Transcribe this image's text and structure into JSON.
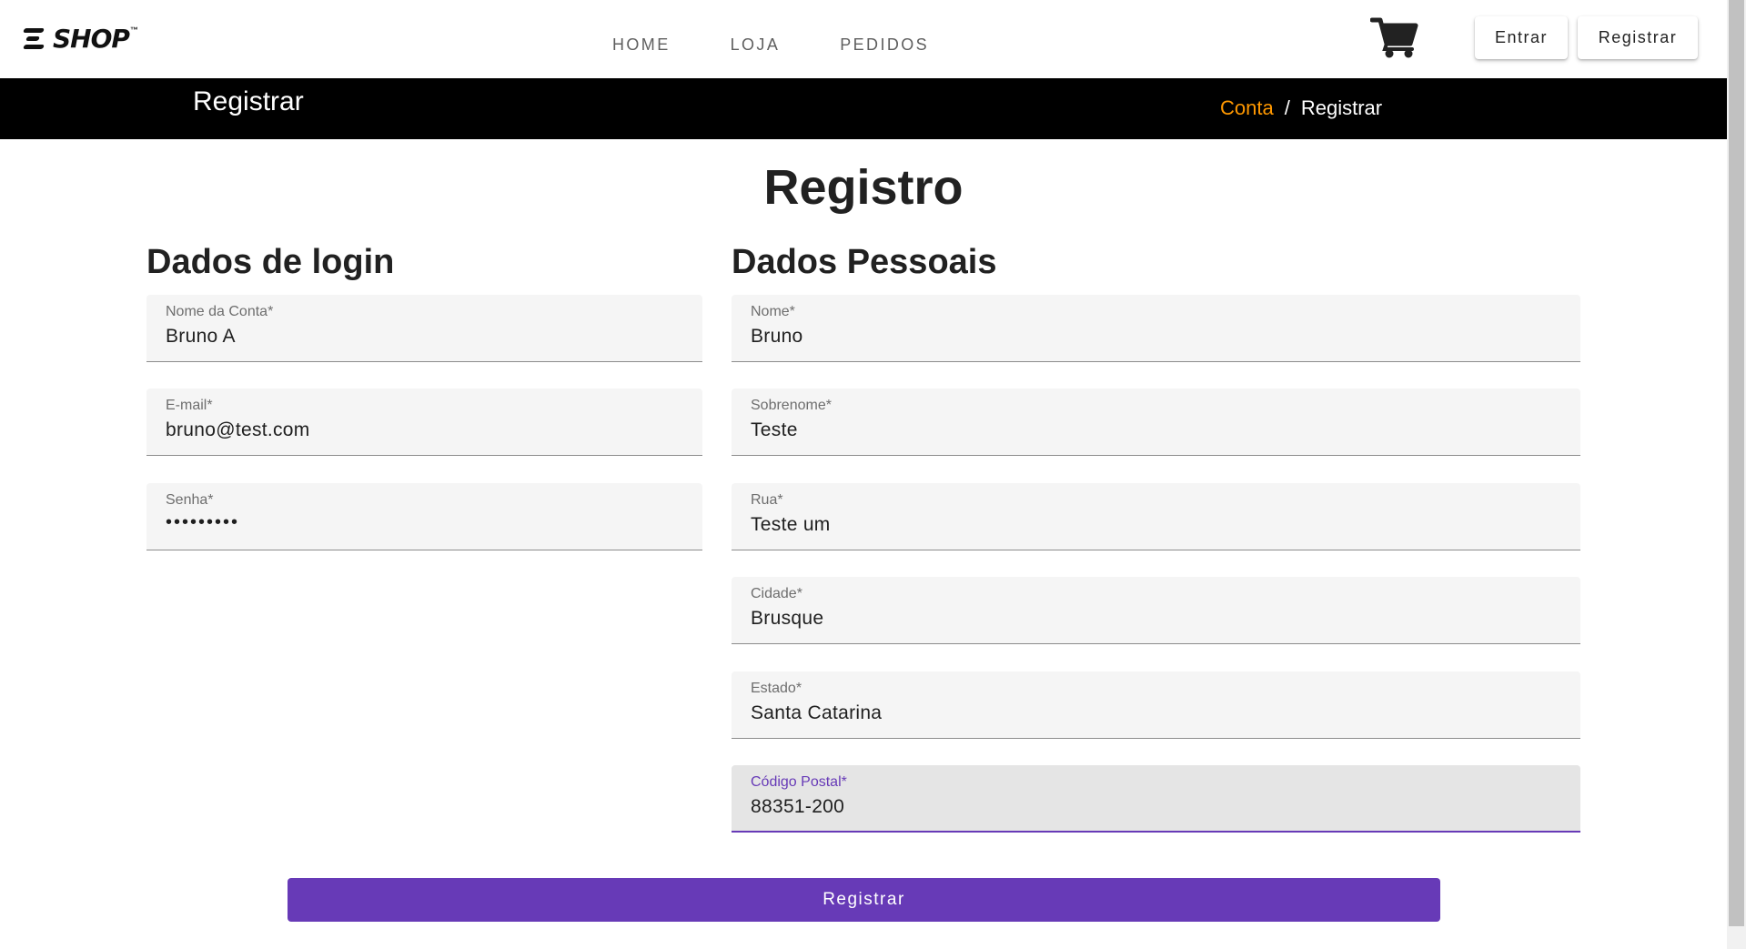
{
  "header": {
    "logo_text": "SHOP",
    "logo_tm": "™",
    "nav": [
      "HOME",
      "LOJA",
      "PEDIDOS"
    ],
    "cart_icon": "shopping-cart-icon",
    "login_label": "Entrar",
    "register_label": "Registrar"
  },
  "banner": {
    "title": "Registrar",
    "breadcrumb": [
      "Conta",
      "/",
      "Registrar"
    ]
  },
  "form": {
    "title": "Registro",
    "login_section": {
      "title": "Dados de login",
      "fields": [
        {
          "label": "Nome da Conta*",
          "value": "Bruno A"
        },
        {
          "label": "E-mail*",
          "value": "bruno@test.com"
        },
        {
          "label": "Senha*",
          "value": "•••••••••"
        }
      ]
    },
    "personal_section": {
      "title": "Dados Pessoais",
      "fields": [
        {
          "label": "Nome*",
          "value": "Bruno"
        },
        {
          "label": "Sobrenome*",
          "value": "Teste"
        },
        {
          "label": "Rua*",
          "value": "Teste um"
        },
        {
          "label": "Cidade*",
          "value": "Brusque"
        },
        {
          "label": "Estado*",
          "value": "Santa Catarina"
        },
        {
          "label": "Código Postal*",
          "value": "88351-200"
        }
      ]
    },
    "submit_label": "Registrar"
  },
  "colors": {
    "accent": "#673ab7",
    "breadcrumb_link": "#ff9800",
    "banner_bg": "#000000"
  }
}
